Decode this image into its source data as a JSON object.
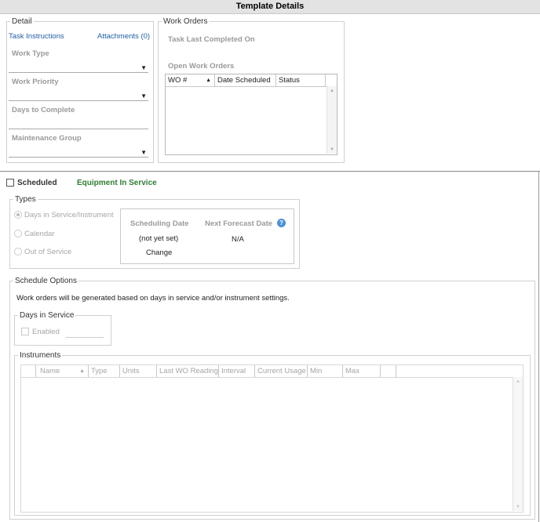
{
  "title": "Template Details",
  "detail": {
    "legend": "Detail",
    "task_instructions": "Task Instructions",
    "attachments": "Attachments (0)",
    "work_type_label": "Work Type",
    "work_priority_label": "Work Priority",
    "days_to_complete_label": "Days to Complete",
    "maintenance_group_label": "Maintenance Group"
  },
  "work_orders": {
    "legend": "Work Orders",
    "task_last_completed": "Task Last Completed On",
    "open_work_orders": "Open Work Orders",
    "columns": [
      "WO #",
      "Date Scheduled",
      "Status"
    ]
  },
  "scheduled": {
    "label": "Scheduled",
    "status": "Equipment In Service",
    "status_color": "#2e7d32"
  },
  "types": {
    "legend": "Types",
    "options": [
      "Days in Service/Instrument",
      "Calendar",
      "Out of Service"
    ],
    "selected": "Days in Service/Instrument",
    "scheduling_date_label": "Scheduling Date",
    "scheduling_date_value": "(not yet set)",
    "change_label": "Change",
    "next_forecast_label": "Next Forecast Date",
    "next_forecast_value": "N/A",
    "help_icon": "question-circle-icon"
  },
  "schedule_options": {
    "legend": "Schedule Options",
    "description": "Work orders will be generated based on days in service and/or instrument settings.",
    "days_in_service_legend": "Days in Service",
    "enabled_label": "Enabled"
  },
  "instruments": {
    "legend": "Instruments",
    "columns": [
      "Name",
      "Type",
      "Units",
      "Last WO Reading",
      "Interval",
      "Current Usage",
      "Min",
      "Max"
    ]
  }
}
